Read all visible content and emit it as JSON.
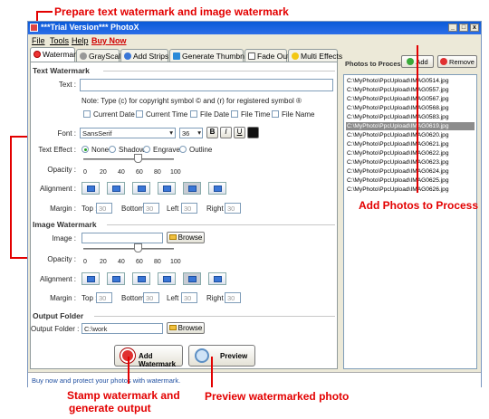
{
  "annotations": {
    "top": "Prepare text watermark and image watermark",
    "add_photos": "Add Photos to Process",
    "stamp_line1": "Stamp watermark and",
    "stamp_line2": "generate output",
    "preview": "Preview watermarked photo"
  },
  "window": {
    "title": "***Trial Version*** PhotoX",
    "controls": [
      "_",
      "□",
      "x"
    ]
  },
  "menu": [
    "File",
    "Tools",
    "Help",
    "Buy Now"
  ],
  "tabs": [
    "Watermark",
    "GrayScale",
    "Add Strips",
    "Generate Thumbnail",
    "Fade Out",
    "Multi Effects"
  ],
  "text_watermark": {
    "section": "Text Watermark",
    "text_label": "Text :",
    "text_value": "",
    "note": "Note: Type (c) for copyright symbol © and (r) for registered symbol ®",
    "checks": [
      "Current Date",
      "Current Time",
      "File Date",
      "File Time",
      "File Name"
    ],
    "font_label": "Font :",
    "font_value": "SansSerif",
    "font_size": "36",
    "style_buttons": [
      "B",
      "I",
      "U"
    ],
    "effect_label": "Text Effect :",
    "effects": [
      "None",
      "Shadow",
      "Engrave",
      "Outline"
    ],
    "effect_selected": "None",
    "opacity_label": "Opacity :",
    "opacity_ticks": [
      "0",
      "20",
      "40",
      "60",
      "80",
      "100"
    ],
    "opacity_value": 60,
    "alignment_label": "Alignment :",
    "margin_label": "Margin :",
    "margin_top_label": "Top :",
    "margin_top": "30",
    "margin_bottom_label": "Bottom :",
    "margin_bottom": "30",
    "margin_left_label": "Left :",
    "margin_left": "30",
    "margin_right_label": "Right :",
    "margin_right": "30"
  },
  "image_watermark": {
    "section": "Image Watermark",
    "image_label": "Image :",
    "image_value": "",
    "browse": "Browse",
    "opacity_label": "Opacity :",
    "opacity_ticks": [
      "0",
      "20",
      "40",
      "60",
      "80",
      "100"
    ],
    "opacity_value": 60,
    "alignment_label": "Alignment :",
    "margin_label": "Margin :",
    "margin_top_label": "Top :",
    "margin_top": "30",
    "margin_bottom_label": "Bottom :",
    "margin_bottom": "30",
    "margin_left_label": "Left :",
    "margin_left": "30",
    "margin_right_label": "Right :",
    "margin_right": "30"
  },
  "output": {
    "section": "Output Folder",
    "folder_label": "Output Folder :",
    "folder_value": "C:\\work",
    "browse": "Browse"
  },
  "actions": {
    "add_watermark": "Add Watermark",
    "preview": "Preview"
  },
  "photos": {
    "title": "Photos to Process",
    "add": "Add",
    "remove": "Remove",
    "items": [
      "C:\\MyPhoto\\PpcUpload\\IMAG0514.jpg",
      "C:\\MyPhoto\\PpcUpload\\IMAG0557.jpg",
      "C:\\MyPhoto\\PpcUpload\\IMAG0567.jpg",
      "C:\\MyPhoto\\PpcUpload\\IMAG0568.jpg",
      "C:\\MyPhoto\\PpcUpload\\IMAG0583.jpg",
      "C:\\MyPhoto\\PpcUpload\\IMAG0619.jpg",
      "C:\\MyPhoto\\PpcUpload\\IMAG0620.jpg",
      "C:\\MyPhoto\\PpcUpload\\IMAG0621.jpg",
      "C:\\MyPhoto\\PpcUpload\\IMAG0622.jpg",
      "C:\\MyPhoto\\PpcUpload\\IMAG0623.jpg",
      "C:\\MyPhoto\\PpcUpload\\IMAG0624.jpg",
      "C:\\MyPhoto\\PpcUpload\\IMAG0625.jpg",
      "C:\\MyPhoto\\PpcUpload\\IMAG0626.jpg"
    ],
    "selected_index": 5
  },
  "status": "Buy now and protect your photos with watermark."
}
